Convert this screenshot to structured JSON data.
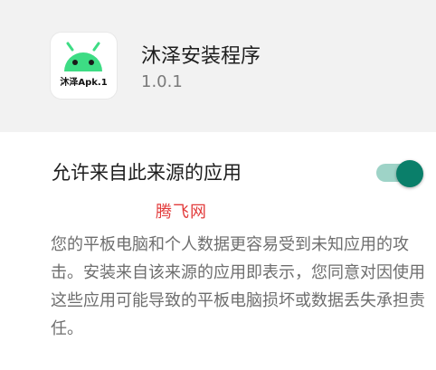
{
  "app": {
    "name": "沐泽安装程序",
    "version": "1.0.1",
    "icon_label": "沐泽Apk.1",
    "icon_color": "#3ddc84"
  },
  "setting": {
    "label": "允许来自此来源的应用",
    "toggle_on": true,
    "toggle_thumb_color": "#0a7f6a",
    "toggle_track_color": "#9ed3c7"
  },
  "watermark": "腾飞网",
  "warning": "您的平板电脑和个人数据更容易受到未知应用的攻击。安装来自该来源的应用即表示，您同意对因使用这些应用可能导致的平板电脑损坏或数据丢失承担责任。"
}
